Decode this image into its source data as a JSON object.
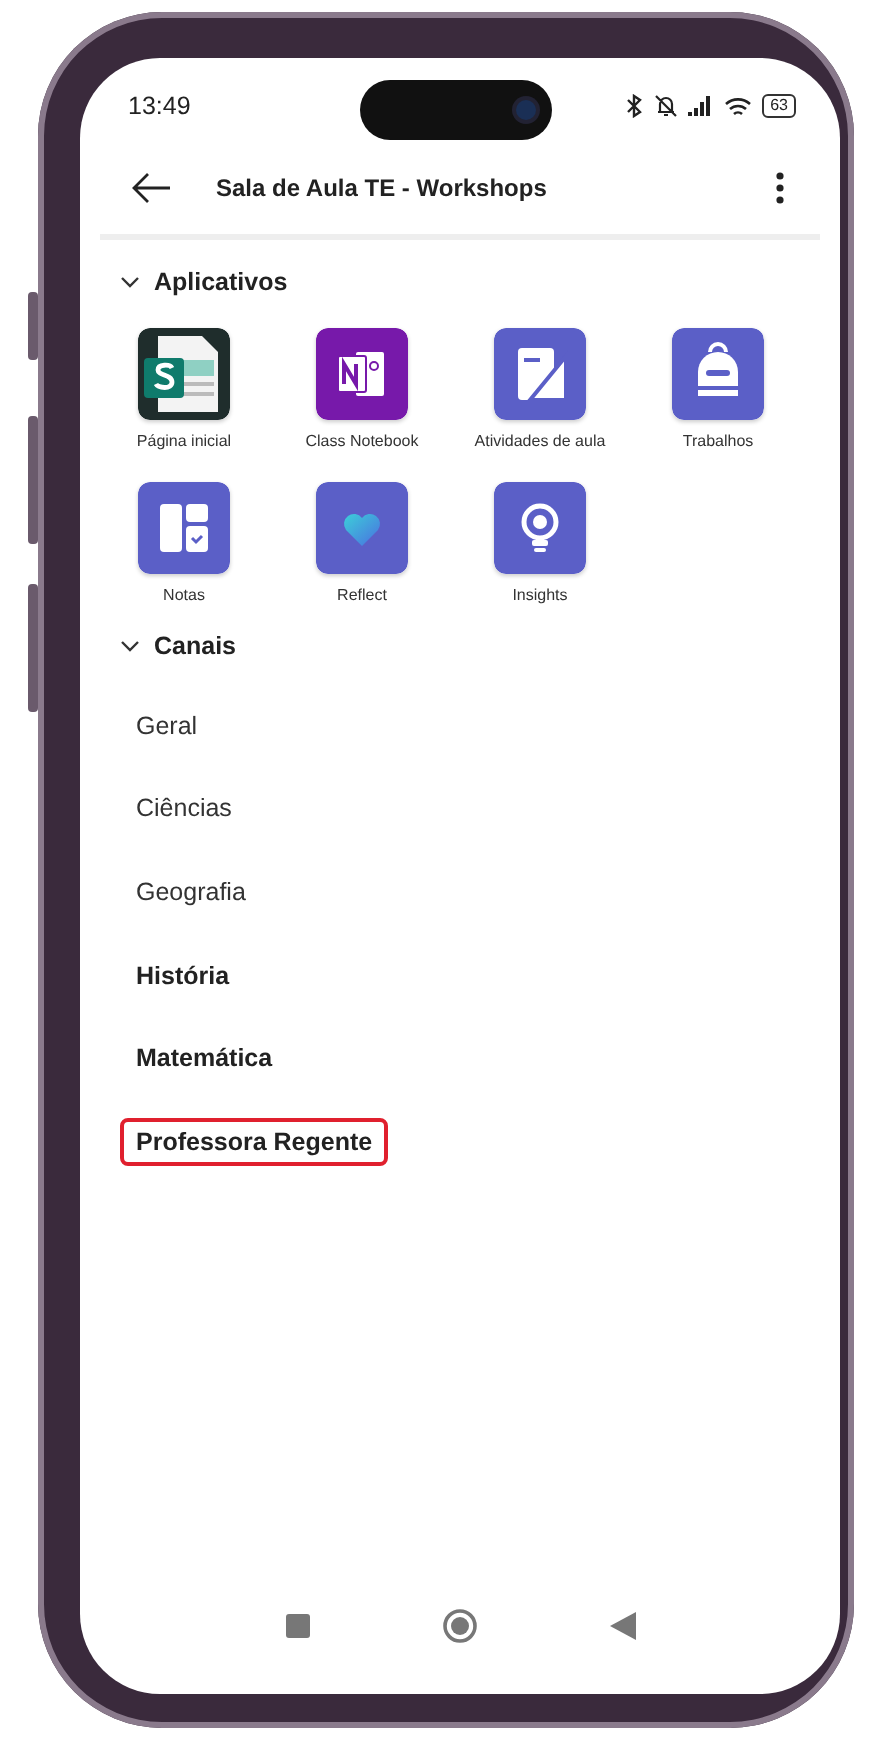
{
  "status_bar": {
    "time": "13:49",
    "battery": "63"
  },
  "header": {
    "title": "Sala de Aula TE - Workshops"
  },
  "sections": [
    {
      "title": "Aplicativos",
      "expanded": true,
      "kind": "apps",
      "items": [
        {
          "label": "Página inicial",
          "kind": "page"
        },
        {
          "label": "Class Notebook",
          "kind": "notebook"
        },
        {
          "label": "Atividades de aula",
          "kind": "activities"
        },
        {
          "label": "Trabalhos",
          "kind": "backpack"
        },
        {
          "label": "Notas",
          "kind": "grades"
        },
        {
          "label": "Reflect",
          "kind": "reflect"
        },
        {
          "label": "Insights",
          "kind": "bulb"
        }
      ]
    },
    {
      "title": "Canais",
      "expanded": true,
      "kind": "channels",
      "items": [
        {
          "label": "Geral",
          "unread": false,
          "highlighted": false
        },
        {
          "label": "Ciências",
          "unread": false,
          "highlighted": false
        },
        {
          "label": "Geografia",
          "unread": false,
          "highlighted": false
        },
        {
          "label": "História",
          "unread": true,
          "highlighted": false
        },
        {
          "label": "Matemática",
          "unread": true,
          "highlighted": false
        },
        {
          "label": "Professora Regente",
          "unread": true,
          "highlighted": true
        }
      ]
    }
  ]
}
